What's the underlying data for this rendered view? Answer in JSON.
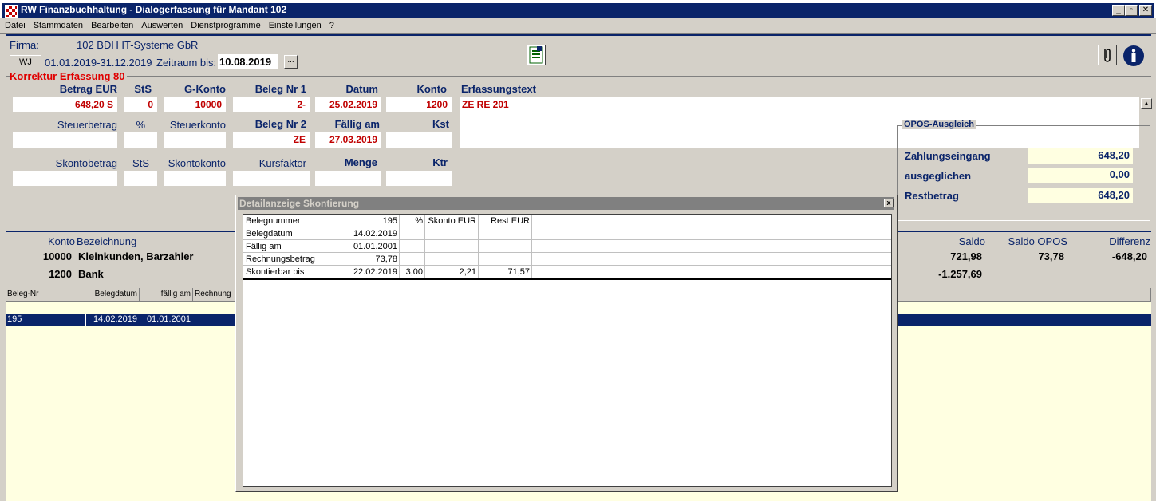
{
  "window": {
    "title": "RW Finanzbuchhaltung - Dialogerfassung für Mandant 102",
    "buttons": [
      "_",
      "▫",
      "✕"
    ]
  },
  "menu": [
    "Datei",
    "Stammdaten",
    "Bearbeiten",
    "Auswerten",
    "Dienstprogramme",
    "Einstellungen",
    "?"
  ],
  "header": {
    "firma_label": "Firma:",
    "firma_value": "102 BDH IT-Systeme GbR",
    "wj_button": "WJ",
    "period": "01.01.2019-31.12.2019",
    "zeitraum_label": "Zeitraum bis:",
    "zeitraum_value": "10.08.2019",
    "zeitraum_button": "..."
  },
  "section_title": "Korrektur Erfassung 80",
  "form": {
    "row1_labels": {
      "betrag": "Betrag EUR",
      "sts": "StS",
      "gkonto": "G-Konto",
      "beleg1": "Beleg Nr 1",
      "datum": "Datum",
      "konto": "Konto",
      "text": "Erfassungstext"
    },
    "row1_values": {
      "betrag": "648,20 S",
      "sts": "0",
      "gkonto": "10000",
      "beleg1": "2-",
      "datum": "25.02.2019",
      "konto": "1200",
      "text": "ZE RE 201"
    },
    "row2_labels": {
      "steuerbetrag": "Steuerbetrag",
      "pct": "%",
      "steuerkonto": "Steuerkonto",
      "beleg2": "Beleg Nr 2",
      "faellig": "Fällig am",
      "kst": "Kst"
    },
    "row2_values": {
      "steuerbetrag": "",
      "pct": "",
      "steuerkonto": "",
      "beleg2": "ZE",
      "faellig": "27.03.2019",
      "kst": ""
    },
    "row3_labels": {
      "skontobetrag": "Skontobetrag",
      "sts": "StS",
      "skontokonto": "Skontokonto",
      "kursfaktor": "Kursfaktor",
      "menge": "Menge",
      "ktr": "Ktr"
    }
  },
  "opos": {
    "title": "OPOS-Ausgleich",
    "rows": [
      {
        "label": "Zahlungseingang",
        "value": "648,20"
      },
      {
        "label": "ausgeglichen",
        "value": "0,00"
      },
      {
        "label": "Restbetrag",
        "value": "648,20"
      }
    ]
  },
  "konten": {
    "headers": {
      "konto": "Konto",
      "bezeichnung": "Bezeichnung",
      "saldo": "Saldo",
      "saldo_opos": "Saldo OPOS",
      "differenz": "Differenz"
    },
    "rows": [
      {
        "konto": "10000",
        "bezeichnung": "Kleinkunden, Barzahler",
        "saldo": "721,98",
        "saldo_opos": "73,78",
        "differenz": "-648,20"
      },
      {
        "konto": "1200",
        "bezeichnung": "Bank",
        "saldo": "-1.257,69",
        "saldo_opos": "",
        "differenz": ""
      }
    ]
  },
  "grid": {
    "headers": [
      "Beleg-Nr",
      "Belegdatum",
      "fällig am",
      "Rechnung"
    ],
    "selected_row": [
      "195",
      "14.02.2019",
      "01.01.2001"
    ]
  },
  "dialog": {
    "title": "Detailanzeige Skontierung",
    "close": "x",
    "header_row": {
      "label": "Belegnummer",
      "value": "195",
      "pct": "%",
      "skonto": "Skonto EUR",
      "rest": "Rest EUR"
    },
    "rows": [
      {
        "label": "Belegdatum",
        "value": "14.02.2019",
        "pct": "",
        "skonto": "",
        "rest": ""
      },
      {
        "label": "Fällig am",
        "value": "01.01.2001",
        "pct": "",
        "skonto": "",
        "rest": ""
      },
      {
        "label": "Rechnungsbetrag",
        "value": "73,78",
        "pct": "",
        "skonto": "",
        "rest": ""
      },
      {
        "label": "Skontierbar bis",
        "value": "22.02.2019",
        "pct": "3,00",
        "skonto": "2,21",
        "rest": "71,57"
      }
    ]
  },
  "colors": {
    "title_bg": "#0a246a",
    "label": "#0a246a",
    "value_red": "#c00000",
    "opos_bg": "#ffffe1"
  }
}
